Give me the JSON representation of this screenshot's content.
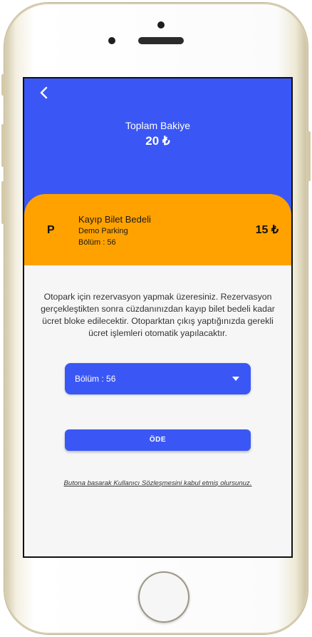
{
  "balance": {
    "label": "Toplam Bakiye",
    "amount": "20 ₺"
  },
  "ticket_card": {
    "icon_letter": "P",
    "title": "Kayıp Bilet Bedeli",
    "parking_name": "Demo Parking",
    "section": "Bölüm : 56",
    "price": "15 ₺",
    "color": "#ffa200"
  },
  "description": "Otopark için rezervasyon yapmak üzeresiniz. Rezervasyon gerçekleştikten sonra cüzdanınızdan kayıp bilet bedeli kadar ücret bloke edilecektir. Otoparktan çıkış yaptığınızda gerekli ücret işlemleri otomatik yapılacaktır.",
  "section_select": {
    "value": "Bölüm : 56"
  },
  "pay_button": {
    "label": "ÖDE"
  },
  "terms_link": "Butona basarak Kullanıcı Sözleşmesini kabul etmiş olursunuz.",
  "icons": {
    "back": "chevron-left-icon",
    "dropdown": "caret-down-icon"
  },
  "colors": {
    "primary": "#3a57f5",
    "accent": "#ffa200",
    "background": "#f6f6f6"
  }
}
